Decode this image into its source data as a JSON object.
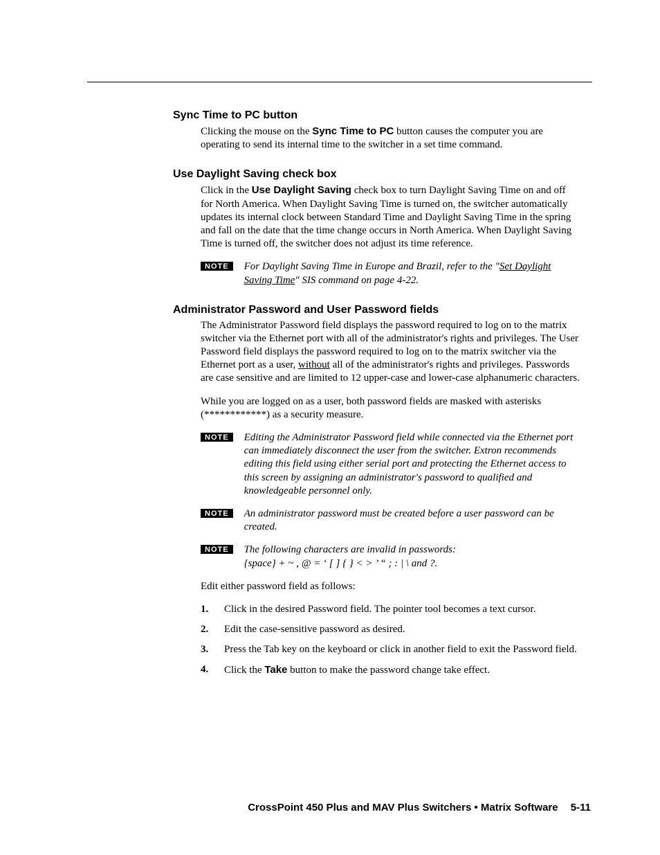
{
  "sections": {
    "sync": {
      "heading": "Sync Time to PC button",
      "p1a": "Clicking the mouse on the ",
      "p1b_bold": "Sync Time to PC",
      "p1c": " button causes the computer you are operating to send its internal time to the switcher in a set time command."
    },
    "daylight": {
      "heading": "Use Daylight Saving check box",
      "p1a": "Click in the ",
      "p1b_bold": "Use Daylight Saving",
      "p1c": " check box to turn Daylight Saving Time on and off for North America.  When Daylight Saving Time is turned on, the switcher automatically updates its internal clock between Standard Time and Daylight Saving Time in the spring and fall on the date that the time change occurs in North America.  When Daylight Saving Time is turned off, the switcher does not adjust its time reference.",
      "note_label": "NOTE",
      "note_a": "For Daylight Saving Time in Europe and Brazil, refer to the \"",
      "note_link": "Set Daylight Saving Time",
      "note_b": "\" SIS command on page 4-22."
    },
    "passwords": {
      "heading": "Administrator Password and User Password fields",
      "p1a": "The Administrator Password field displays the password required to log on to the matrix switcher via the Ethernet port with all of the administrator's rights and privileges.  The User Password field displays the password required to log on to the matrix switcher via the Ethernet port as a user, ",
      "p1_ul": "without",
      "p1b": " all of the administrator's rights and privileges.  Passwords are case sensitive and are limited to 12 upper-case and lower-case alphanumeric characters.",
      "p2": "While you are logged on as a user, both password fields are masked with asterisks (************) as a security measure.",
      "note1_label": "NOTE",
      "note1": "Editing the Administrator Password field while connected via the Ethernet port can immediately disconnect the user from the switcher.  Extron recommends editing this field using either serial port and protecting the Ethernet access to this screen by assigning an administrator's password to qualified and knowledgeable personnel only.",
      "note2_label": "NOTE",
      "note2": "An administrator password must be created before a user password can be created.",
      "note3_label": "NOTE",
      "note3_line1": "The following characters are invalid in passwords:",
      "note3_line2": "{space}  +  ~  ,  @  =  ‘  [  ]  {  }  <  >  ’  “  ;  :  |  \\  and ?.",
      "p3": "Edit either password field as follows:",
      "steps": [
        "Click in the desired Password field.  The pointer tool becomes a text cursor.",
        "Edit the case-sensitive password as desired.",
        "Press the Tab key on the keyboard or click in another field to exit the Password field."
      ],
      "step4_a": "Click the ",
      "step4_bold": "Take",
      "step4_b": " button to make the password change take effect."
    }
  },
  "footer": {
    "title": "CrossPoint 450 Plus and MAV Plus Switchers • Matrix Software",
    "page": "5-11"
  }
}
